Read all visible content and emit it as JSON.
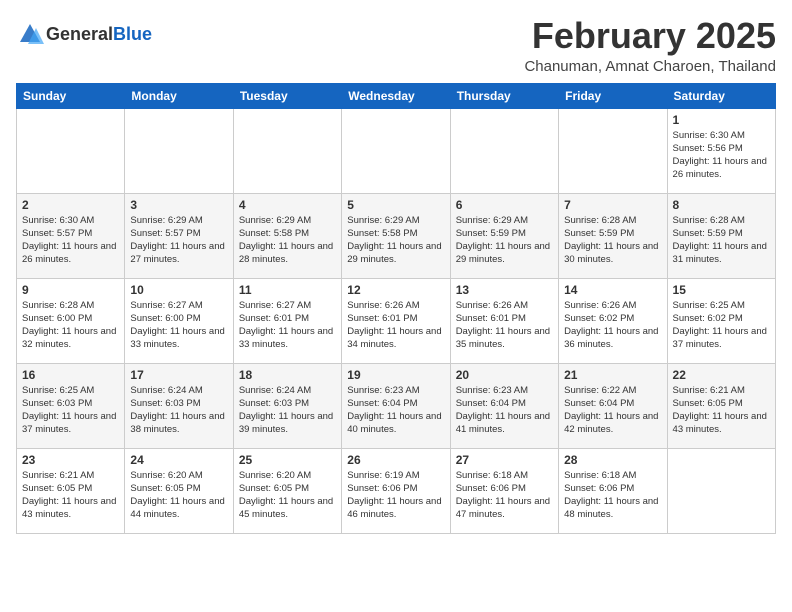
{
  "header": {
    "logo_general": "General",
    "logo_blue": "Blue",
    "month_title": "February 2025",
    "location": "Chanuman, Amnat Charoen, Thailand"
  },
  "weekdays": [
    "Sunday",
    "Monday",
    "Tuesday",
    "Wednesday",
    "Thursday",
    "Friday",
    "Saturday"
  ],
  "weeks": [
    [
      {
        "day": "",
        "info": ""
      },
      {
        "day": "",
        "info": ""
      },
      {
        "day": "",
        "info": ""
      },
      {
        "day": "",
        "info": ""
      },
      {
        "day": "",
        "info": ""
      },
      {
        "day": "",
        "info": ""
      },
      {
        "day": "1",
        "info": "Sunrise: 6:30 AM\nSunset: 5:56 PM\nDaylight: 11 hours and 26 minutes."
      }
    ],
    [
      {
        "day": "2",
        "info": "Sunrise: 6:30 AM\nSunset: 5:57 PM\nDaylight: 11 hours and 26 minutes."
      },
      {
        "day": "3",
        "info": "Sunrise: 6:29 AM\nSunset: 5:57 PM\nDaylight: 11 hours and 27 minutes."
      },
      {
        "day": "4",
        "info": "Sunrise: 6:29 AM\nSunset: 5:58 PM\nDaylight: 11 hours and 28 minutes."
      },
      {
        "day": "5",
        "info": "Sunrise: 6:29 AM\nSunset: 5:58 PM\nDaylight: 11 hours and 29 minutes."
      },
      {
        "day": "6",
        "info": "Sunrise: 6:29 AM\nSunset: 5:59 PM\nDaylight: 11 hours and 29 minutes."
      },
      {
        "day": "7",
        "info": "Sunrise: 6:28 AM\nSunset: 5:59 PM\nDaylight: 11 hours and 30 minutes."
      },
      {
        "day": "8",
        "info": "Sunrise: 6:28 AM\nSunset: 5:59 PM\nDaylight: 11 hours and 31 minutes."
      }
    ],
    [
      {
        "day": "9",
        "info": "Sunrise: 6:28 AM\nSunset: 6:00 PM\nDaylight: 11 hours and 32 minutes."
      },
      {
        "day": "10",
        "info": "Sunrise: 6:27 AM\nSunset: 6:00 PM\nDaylight: 11 hours and 33 minutes."
      },
      {
        "day": "11",
        "info": "Sunrise: 6:27 AM\nSunset: 6:01 PM\nDaylight: 11 hours and 33 minutes."
      },
      {
        "day": "12",
        "info": "Sunrise: 6:26 AM\nSunset: 6:01 PM\nDaylight: 11 hours and 34 minutes."
      },
      {
        "day": "13",
        "info": "Sunrise: 6:26 AM\nSunset: 6:01 PM\nDaylight: 11 hours and 35 minutes."
      },
      {
        "day": "14",
        "info": "Sunrise: 6:26 AM\nSunset: 6:02 PM\nDaylight: 11 hours and 36 minutes."
      },
      {
        "day": "15",
        "info": "Sunrise: 6:25 AM\nSunset: 6:02 PM\nDaylight: 11 hours and 37 minutes."
      }
    ],
    [
      {
        "day": "16",
        "info": "Sunrise: 6:25 AM\nSunset: 6:03 PM\nDaylight: 11 hours and 37 minutes."
      },
      {
        "day": "17",
        "info": "Sunrise: 6:24 AM\nSunset: 6:03 PM\nDaylight: 11 hours and 38 minutes."
      },
      {
        "day": "18",
        "info": "Sunrise: 6:24 AM\nSunset: 6:03 PM\nDaylight: 11 hours and 39 minutes."
      },
      {
        "day": "19",
        "info": "Sunrise: 6:23 AM\nSunset: 6:04 PM\nDaylight: 11 hours and 40 minutes."
      },
      {
        "day": "20",
        "info": "Sunrise: 6:23 AM\nSunset: 6:04 PM\nDaylight: 11 hours and 41 minutes."
      },
      {
        "day": "21",
        "info": "Sunrise: 6:22 AM\nSunset: 6:04 PM\nDaylight: 11 hours and 42 minutes."
      },
      {
        "day": "22",
        "info": "Sunrise: 6:21 AM\nSunset: 6:05 PM\nDaylight: 11 hours and 43 minutes."
      }
    ],
    [
      {
        "day": "23",
        "info": "Sunrise: 6:21 AM\nSunset: 6:05 PM\nDaylight: 11 hours and 43 minutes."
      },
      {
        "day": "24",
        "info": "Sunrise: 6:20 AM\nSunset: 6:05 PM\nDaylight: 11 hours and 44 minutes."
      },
      {
        "day": "25",
        "info": "Sunrise: 6:20 AM\nSunset: 6:05 PM\nDaylight: 11 hours and 45 minutes."
      },
      {
        "day": "26",
        "info": "Sunrise: 6:19 AM\nSunset: 6:06 PM\nDaylight: 11 hours and 46 minutes."
      },
      {
        "day": "27",
        "info": "Sunrise: 6:18 AM\nSunset: 6:06 PM\nDaylight: 11 hours and 47 minutes."
      },
      {
        "day": "28",
        "info": "Sunrise: 6:18 AM\nSunset: 6:06 PM\nDaylight: 11 hours and 48 minutes."
      },
      {
        "day": "",
        "info": ""
      }
    ]
  ]
}
